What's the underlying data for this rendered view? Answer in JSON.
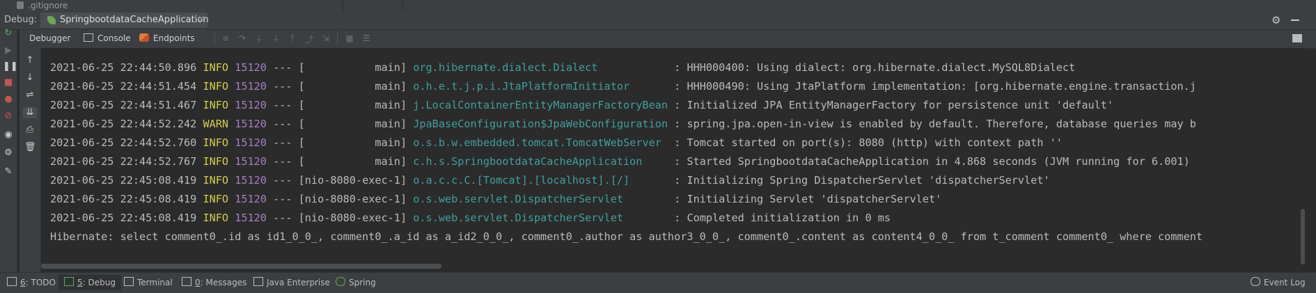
{
  "top": {
    "gitignore_label": ".gitignore"
  },
  "debug_header": {
    "label": "Debug:",
    "tab_name": "SpringbootdataCacheApplication",
    "close_glyph": "×"
  },
  "toolbar": {
    "tabs": [
      {
        "label": "Debugger"
      },
      {
        "label": "Console"
      },
      {
        "label": "Endpoints"
      }
    ]
  },
  "log": {
    "lines": [
      {
        "date": "2021-06-25 22:44:50.896",
        "level": "INFO",
        "pid": "15120",
        "thread": "[           main]",
        "logger": "org.hibernate.dialect.Dialect",
        "message": ": HHH000400: Using dialect: org.hibernate.dialect.MySQL8Dialect"
      },
      {
        "date": "2021-06-25 22:44:51.454",
        "level": "INFO",
        "pid": "15120",
        "thread": "[           main]",
        "logger": "o.h.e.t.j.p.i.JtaPlatformInitiator",
        "message": ": HHH000490: Using JtaPlatform implementation: [org.hibernate.engine.transaction.j"
      },
      {
        "date": "2021-06-25 22:44:51.467",
        "level": "INFO",
        "pid": "15120",
        "thread": "[           main]",
        "logger": "j.LocalContainerEntityManagerFactoryBean",
        "message": ": Initialized JPA EntityManagerFactory for persistence unit 'default'"
      },
      {
        "date": "2021-06-25 22:44:52.242",
        "level": "WARN",
        "pid": "15120",
        "thread": "[           main]",
        "logger": "JpaBaseConfiguration$JpaWebConfiguration",
        "message": ": spring.jpa.open-in-view is enabled by default. Therefore, database queries may b"
      },
      {
        "date": "2021-06-25 22:44:52.760",
        "level": "INFO",
        "pid": "15120",
        "thread": "[           main]",
        "logger": "o.s.b.w.embedded.tomcat.TomcatWebServer",
        "message": ": Tomcat started on port(s): 8080 (http) with context path ''"
      },
      {
        "date": "2021-06-25 22:44:52.767",
        "level": "INFO",
        "pid": "15120",
        "thread": "[           main]",
        "logger": "c.h.s.SpringbootdataCacheApplication",
        "message": ": Started SpringbootdataCacheApplication in 4.868 seconds (JVM running for 6.001)"
      },
      {
        "date": "2021-06-25 22:45:08.419",
        "level": "INFO",
        "pid": "15120",
        "thread": "[nio-8080-exec-1]",
        "logger": "o.a.c.c.C.[Tomcat].[localhost].[/]",
        "message": ": Initializing Spring DispatcherServlet 'dispatcherServlet'"
      },
      {
        "date": "2021-06-25 22:45:08.419",
        "level": "INFO",
        "pid": "15120",
        "thread": "[nio-8080-exec-1]",
        "logger": "o.s.web.servlet.DispatcherServlet",
        "message": ": Initializing Servlet 'dispatcherServlet'"
      },
      {
        "date": "2021-06-25 22:45:08.419",
        "level": "INFO",
        "pid": "15120",
        "thread": "[nio-8080-exec-1]",
        "logger": "o.s.web.servlet.DispatcherServlet",
        "message": ": Completed initialization in 0 ms"
      }
    ],
    "hibernate_line": "Hibernate: select comment0_.id as id1_0_0_, comment0_.a_id as a_id2_0_0_, comment0_.author as author3_0_0_, comment0_.content as content4_0_0_ from t_comment comment0_ where comment"
  },
  "bottom": {
    "todo": {
      "num": "6",
      "label": ": TODO"
    },
    "debug": {
      "num": "5",
      "label": ": Debug"
    },
    "terminal": {
      "label": "Terminal"
    },
    "messages": {
      "num": "0",
      "label": ": Messages"
    },
    "java_enterprise": {
      "label": "Java Enterprise"
    },
    "spring": {
      "label": "Spring"
    },
    "event_log": {
      "label": "Event Log"
    }
  },
  "colors": {
    "background": "#2b2b2b",
    "panel": "#3c3f41",
    "info": "#d4ce4a",
    "pid": "#a47fc6",
    "logger": "#3f9f9f"
  }
}
